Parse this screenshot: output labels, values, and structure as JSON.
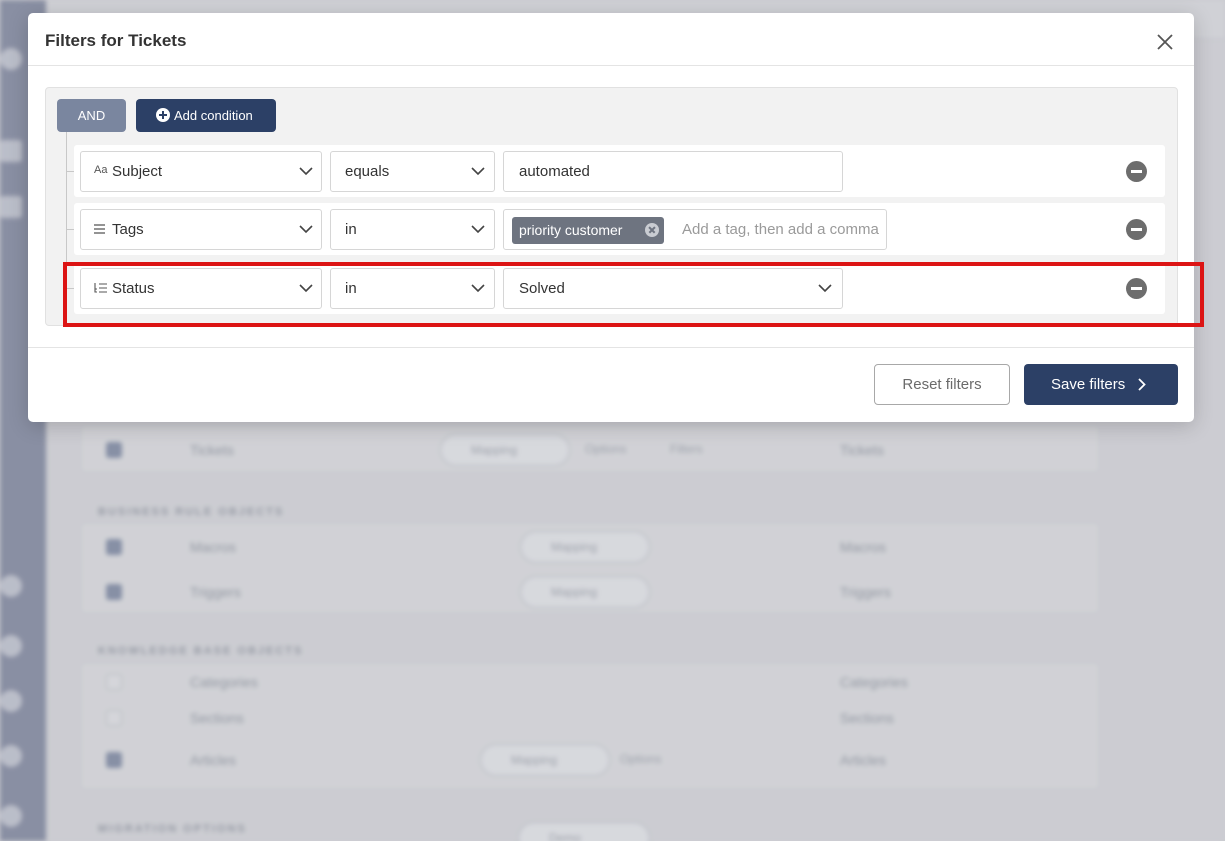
{
  "modal": {
    "title": "Filters for Tickets",
    "and_label": "AND",
    "add_condition_label": "Add condition",
    "conditions": [
      {
        "field_icon": "Aa",
        "field": "Subject",
        "operator": "equals",
        "value": "automated"
      },
      {
        "field_icon": "list-icon",
        "field": "Tags",
        "operator": "in",
        "tag": "priority customer",
        "placeholder": "Add a tag, then add a comma"
      },
      {
        "field_icon": "status-list-icon",
        "field": "Status",
        "operator": "in",
        "value": "Solved"
      }
    ],
    "reset_label": "Reset filters",
    "save_label": "Save filters"
  },
  "background": {
    "rows": [
      {
        "name": "Tickets",
        "pill": "Mapping",
        "options": "Options",
        "filters": "Filters",
        "target": "Tickets"
      },
      {
        "section": "BUSINESS RULE OBJECTS"
      },
      {
        "name": "Macros",
        "pill": "Mapping",
        "target": "Macros"
      },
      {
        "name": "Triggers",
        "pill": "Mapping",
        "target": "Triggers"
      },
      {
        "section": "KNOWLEDGE BASE OBJECTS"
      },
      {
        "name": "Categories",
        "target": "Categories"
      },
      {
        "name": "Sections",
        "target": "Sections"
      },
      {
        "name": "Articles",
        "pill": "Mapping",
        "options": "Options",
        "target": "Articles"
      },
      {
        "section": "MIGRATION OPTIONS",
        "pill": "Demo"
      }
    ]
  },
  "colors": {
    "primary": "#2c4066",
    "and_button": "#7a869f",
    "highlight": "#dc1414"
  }
}
